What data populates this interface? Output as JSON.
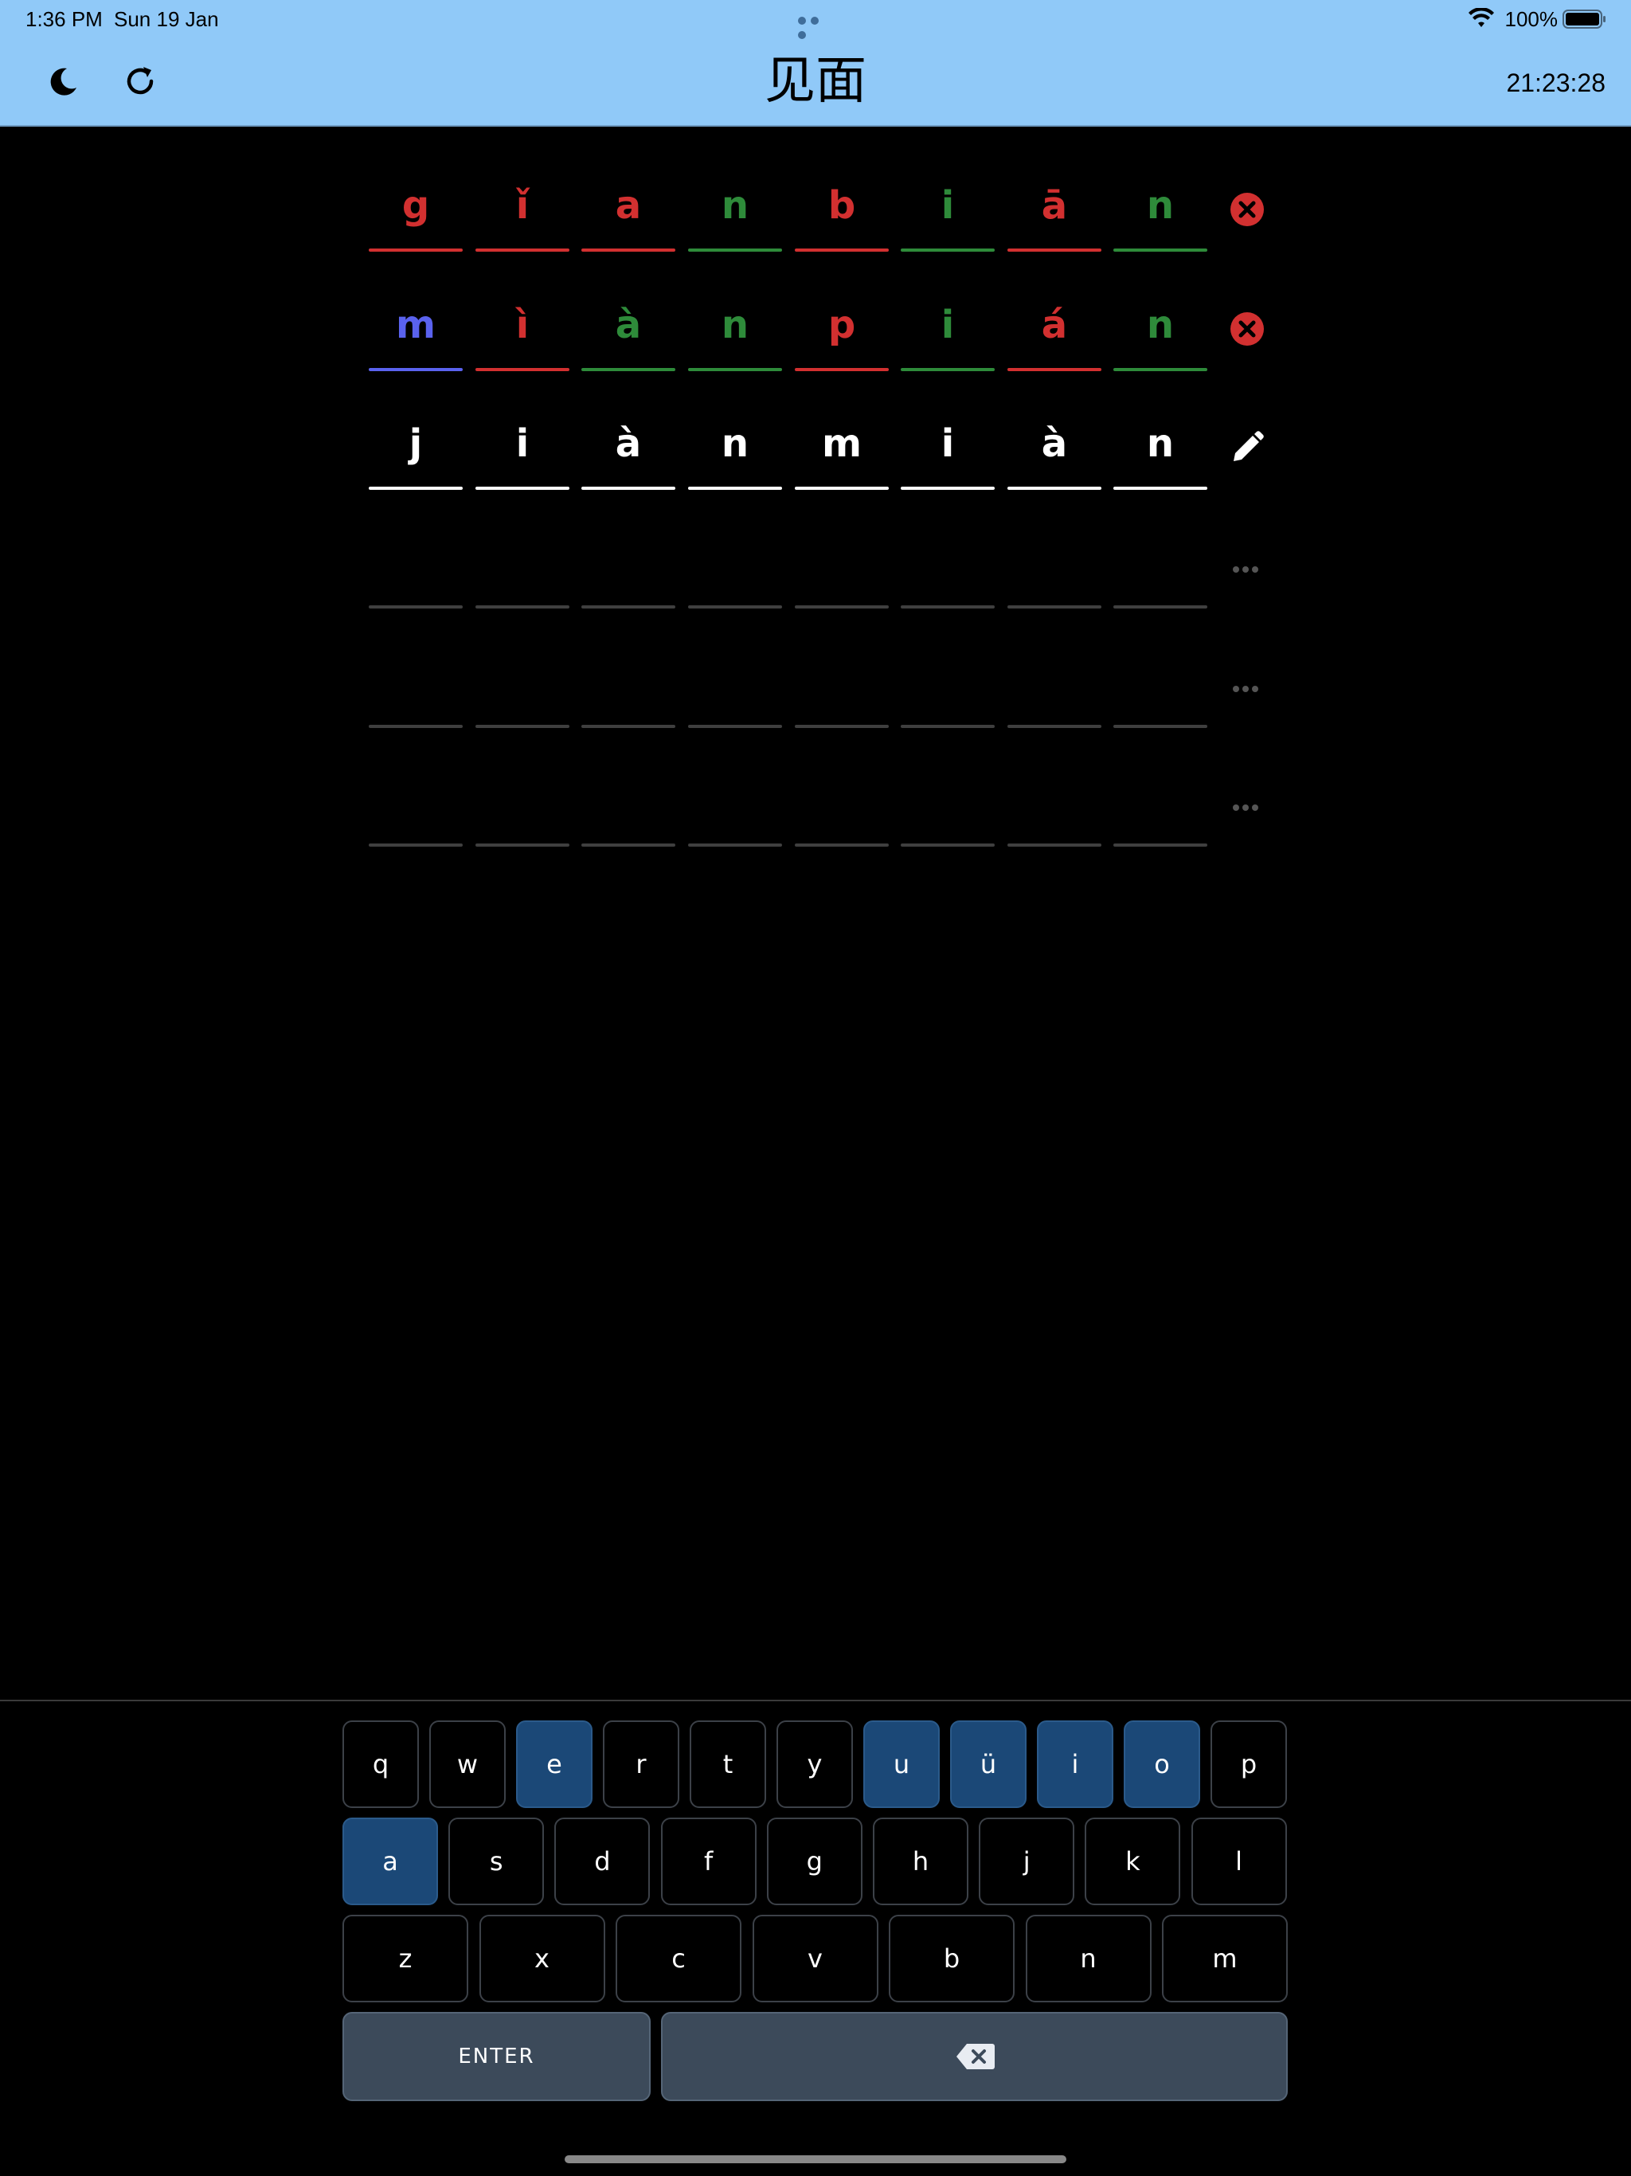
{
  "status_bar": {
    "time": "1:36 PM",
    "date": "Sun 19 Jan",
    "battery": "100%"
  },
  "header": {
    "title": "见面",
    "timer": "21:23:28",
    "left_icons": [
      "moon-icon",
      "refresh-icon"
    ]
  },
  "colors": {
    "header_bg": "#90c9f8",
    "correct": "#2e8b3a",
    "wrong": "#d23030",
    "present": "#5a62ee",
    "active": "#ffffff",
    "empty": "#3f3f3f",
    "vowel_key": "#1b4877",
    "action_key": "#3c4a5a"
  },
  "grid": {
    "rows": [
      {
        "state": "submitted",
        "status_icon": "x-circle-icon",
        "cells": [
          {
            "letter": "g",
            "status": "wrong"
          },
          {
            "letter": "ǐ",
            "status": "wrong"
          },
          {
            "letter": "a",
            "status": "wrong"
          },
          {
            "letter": "n",
            "status": "correct"
          },
          {
            "letter": "b",
            "status": "wrong"
          },
          {
            "letter": "i",
            "status": "correct"
          },
          {
            "letter": "ā",
            "status": "wrong"
          },
          {
            "letter": "n",
            "status": "correct"
          }
        ]
      },
      {
        "state": "submitted",
        "status_icon": "x-circle-icon",
        "cells": [
          {
            "letter": "m",
            "status": "present"
          },
          {
            "letter": "ì",
            "status": "wrong"
          },
          {
            "letter": "à",
            "status": "correct"
          },
          {
            "letter": "n",
            "status": "correct"
          },
          {
            "letter": "p",
            "status": "wrong"
          },
          {
            "letter": "i",
            "status": "correct"
          },
          {
            "letter": "á",
            "status": "wrong"
          },
          {
            "letter": "n",
            "status": "correct"
          }
        ]
      },
      {
        "state": "active",
        "status_icon": "pencil-icon",
        "cells": [
          {
            "letter": "j",
            "status": "active"
          },
          {
            "letter": "i",
            "status": "active"
          },
          {
            "letter": "à",
            "status": "active"
          },
          {
            "letter": "n",
            "status": "active"
          },
          {
            "letter": "m",
            "status": "active"
          },
          {
            "letter": "i",
            "status": "active"
          },
          {
            "letter": "à",
            "status": "active"
          },
          {
            "letter": "n",
            "status": "active"
          }
        ]
      },
      {
        "state": "empty",
        "status_icon": "ellipsis-icon",
        "cells": [
          {
            "letter": "",
            "status": "empty"
          },
          {
            "letter": "",
            "status": "empty"
          },
          {
            "letter": "",
            "status": "empty"
          },
          {
            "letter": "",
            "status": "empty"
          },
          {
            "letter": "",
            "status": "empty"
          },
          {
            "letter": "",
            "status": "empty"
          },
          {
            "letter": "",
            "status": "empty"
          },
          {
            "letter": "",
            "status": "empty"
          }
        ]
      },
      {
        "state": "empty",
        "status_icon": "ellipsis-icon",
        "cells": [
          {
            "letter": "",
            "status": "empty"
          },
          {
            "letter": "",
            "status": "empty"
          },
          {
            "letter": "",
            "status": "empty"
          },
          {
            "letter": "",
            "status": "empty"
          },
          {
            "letter": "",
            "status": "empty"
          },
          {
            "letter": "",
            "status": "empty"
          },
          {
            "letter": "",
            "status": "empty"
          },
          {
            "letter": "",
            "status": "empty"
          }
        ]
      },
      {
        "state": "empty",
        "status_icon": "ellipsis-icon",
        "cells": [
          {
            "letter": "",
            "status": "empty"
          },
          {
            "letter": "",
            "status": "empty"
          },
          {
            "letter": "",
            "status": "empty"
          },
          {
            "letter": "",
            "status": "empty"
          },
          {
            "letter": "",
            "status": "empty"
          },
          {
            "letter": "",
            "status": "empty"
          },
          {
            "letter": "",
            "status": "empty"
          },
          {
            "letter": "",
            "status": "empty"
          }
        ]
      }
    ]
  },
  "keyboard": {
    "rows": [
      [
        {
          "label": "q"
        },
        {
          "label": "w"
        },
        {
          "label": "e",
          "vowel": true
        },
        {
          "label": "r"
        },
        {
          "label": "t"
        },
        {
          "label": "y"
        },
        {
          "label": "u",
          "vowel": true
        },
        {
          "label": "ü",
          "vowel": true
        },
        {
          "label": "i",
          "vowel": true
        },
        {
          "label": "o",
          "vowel": true
        },
        {
          "label": "p"
        }
      ],
      [
        {
          "label": "a",
          "vowel": true
        },
        {
          "label": "s"
        },
        {
          "label": "d"
        },
        {
          "label": "f"
        },
        {
          "label": "g"
        },
        {
          "label": "h"
        },
        {
          "label": "j"
        },
        {
          "label": "k"
        },
        {
          "label": "l"
        }
      ],
      [
        {
          "label": "z"
        },
        {
          "label": "x"
        },
        {
          "label": "c"
        },
        {
          "label": "v"
        },
        {
          "label": "b"
        },
        {
          "label": "n"
        },
        {
          "label": "m"
        }
      ]
    ],
    "enter_label": "ENTER",
    "backspace_icon": "backspace-icon"
  }
}
